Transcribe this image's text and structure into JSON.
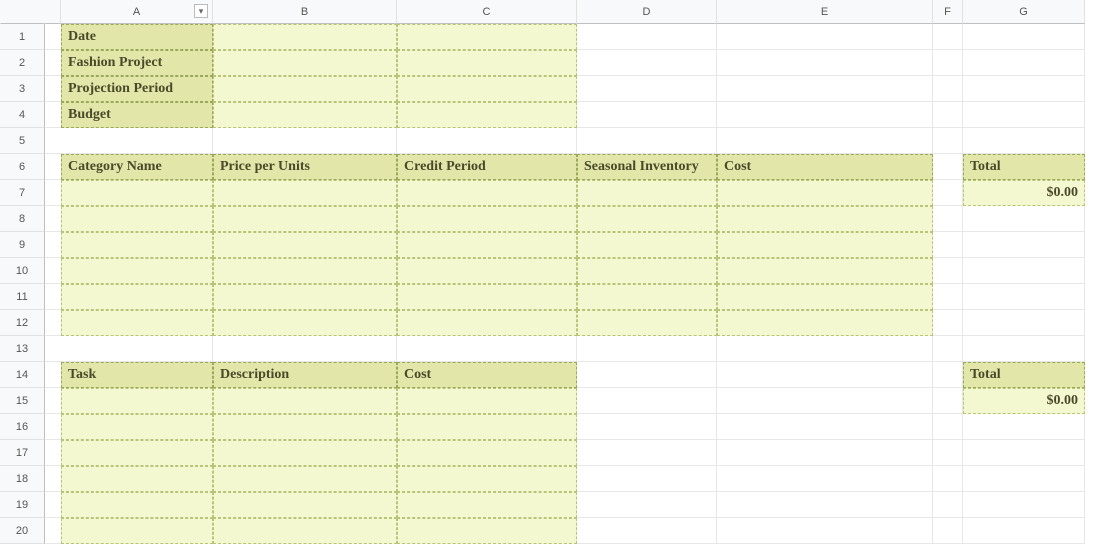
{
  "columns": [
    "A",
    "B",
    "C",
    "D",
    "E",
    "F",
    "G"
  ],
  "rows": [
    "1",
    "2",
    "3",
    "4",
    "5",
    "6",
    "7",
    "8",
    "9",
    "10",
    "11",
    "12",
    "13",
    "14",
    "15",
    "16",
    "17",
    "18",
    "19",
    "20"
  ],
  "labels": {
    "r1a": "Date",
    "r2a": "Fashion Project",
    "r3a": "Projection Period",
    "r4a": "Budget",
    "r6a": "Category Name",
    "r6b": "Price per Units",
    "r6c": "Credit Period",
    "r6d": "Seasonal Inventory",
    "r6e": "Cost",
    "r6g": "Total",
    "r7g": "$0.00",
    "r14a": "Task",
    "r14b": "Description",
    "r14c": "Cost",
    "r14g": "Total",
    "r15g": "$0.00"
  }
}
